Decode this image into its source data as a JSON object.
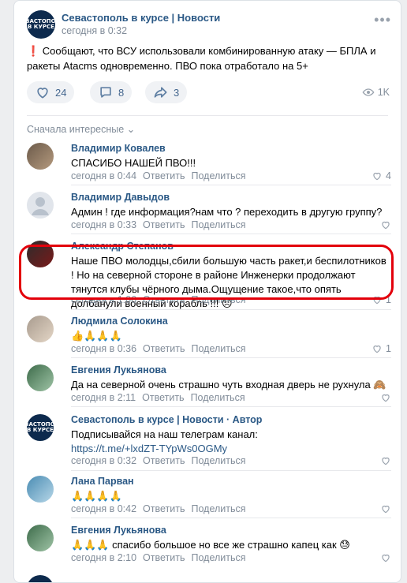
{
  "post": {
    "group_name": "Севастополь в курсе | Новости",
    "group_logo_text": "СЕВАСТОПОЛЬ В КУРСЕ",
    "time": "сегодня в 0:32",
    "text": "❗️ Сообщают, что ВСУ использовали комбинированную атаку — БПЛА и ракеты Atacms одновременно. ПВО пока отработало на 5+",
    "likes": "24",
    "comments": "8",
    "shares": "3",
    "views": "1K"
  },
  "sort_label": "Сначала интересные",
  "reply_label": "Ответить",
  "share_label": "Поделиться",
  "comments": [
    {
      "author": "Владимир Ковалев",
      "text": "СПАСИБО НАШЕЙ ПВО!!!",
      "time": "сегодня в 0:44",
      "likes": "4"
    },
    {
      "author": "Владимир Давыдов",
      "text": "Админ ! где информация?нам что ? переходить в другую группу?",
      "time": "сегодня в 0:33",
      "likes": ""
    },
    {
      "author": "Александр Степанов",
      "text": "Наше ПВО молодцы,сбили большую часть ракет,и беспилотников ! Но на северной стороне в районе Инженерки продолжают тянутся клубы чёрного дыма.Ощущение такое,что опять долбанули военный корабль !!! 😠",
      "time": "сегодня в 1:06",
      "likes": "1"
    },
    {
      "author": "Людмила Солокина",
      "text": "👍🙏🙏🙏",
      "time": "сегодня в 0:36",
      "likes": "1"
    },
    {
      "author": "Евгения Лукьянова",
      "text": "Да на северной очень страшно чуть входная дверь не рухнула 🙈",
      "time": "сегодня в 2:11",
      "likes": ""
    },
    {
      "author": "Севастополь в курсе | Новости · Автор",
      "text": "Подписывайся на наш телеграм канал:",
      "link": "https://t.me/+lxdZT-TYpWs0OGMy",
      "time": "сегодня в 0:32",
      "likes": ""
    },
    {
      "author": "Лана Парван",
      "text": "🙏🙏🙏🙏",
      "time": "сегодня в 0:42",
      "likes": ""
    },
    {
      "author": "Евгения Лукьянова",
      "text": "🙏🙏🙏 спасибо большое но все же страшно капец как 😓",
      "time": "сегодня в 2:10",
      "likes": ""
    }
  ],
  "colors": {
    "accent": "#2a5885",
    "meta": "#818c99",
    "highlight": "#e3000b"
  }
}
